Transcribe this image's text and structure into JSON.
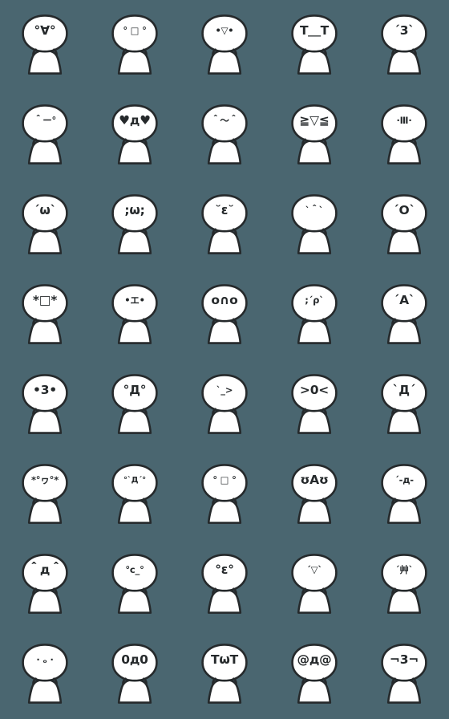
{
  "page": {
    "title": "Kaomoji Blob Emoji Sticker Sheet",
    "background_color": "#4a6670",
    "blob_fill": "#ffffff",
    "blob_outline": "#25292b",
    "face_color": "#25292b",
    "columns": 5,
    "rows": 8,
    "total": 40
  },
  "emojis": [
    {
      "index": 1,
      "face": "°∀°",
      "name": "emoji-happy-open-eyes",
      "size": "f-lg"
    },
    {
      "index": 2,
      "face": "° □ °",
      "name": "emoji-square-mouth-shock",
      "size": "f-sm"
    },
    {
      "index": 3,
      "face": "•▽•",
      "name": "emoji-small-triangle-smile",
      "size": "f-sm"
    },
    {
      "index": 4,
      "face": "T＿T",
      "name": "emoji-crying-tears",
      "size": "f-lg"
    },
    {
      "index": 5,
      "face": "´3`",
      "name": "emoji-kiss-pucker",
      "size": "f-lg"
    },
    {
      "index": 6,
      "face": "＾ー°",
      "name": "emoji-wink-smirk",
      "size": "f-sm"
    },
    {
      "index": 7,
      "face": "♥д♥",
      "name": "emoji-heart-eyes",
      "size": "f-lg"
    },
    {
      "index": 8,
      "face": "＾～＾",
      "name": "emoji-content-wavy-mouth",
      "size": "f-sm"
    },
    {
      "index": 9,
      "face": "≧▽≦",
      "name": "emoji-delighted-squint",
      "size": "f-lg"
    },
    {
      "index": 10,
      "face": "·Ⅲ·",
      "name": "emoji-grid-mouth",
      "size": "f-sm"
    },
    {
      "index": 11,
      "face": "´ω`",
      "name": "emoji-omega-smile",
      "size": "f-lg"
    },
    {
      "index": 12,
      "face": ";ω;",
      "name": "emoji-teary-omega",
      "size": "f-lg"
    },
    {
      "index": 13,
      "face": "˘ε˘",
      "name": "emoji-closed-eyes-kiss",
      "size": "f-lg"
    },
    {
      "index": 14,
      "face": "`＾`",
      "name": "emoji-worried-frown",
      "size": "f-sm"
    },
    {
      "index": 15,
      "face": "´O`",
      "name": "emoji-surprised-oval",
      "size": "f-lg"
    },
    {
      "index": 16,
      "face": "*□*",
      "name": "emoji-starry-square-mouth",
      "size": "f-lg"
    },
    {
      "index": 17,
      "face": "•エ•",
      "name": "emoji-katakana-e-mouth",
      "size": "f-sm"
    },
    {
      "index": 18,
      "face": "o∩o",
      "name": "emoji-arch-mouth",
      "size": "f-lg"
    },
    {
      "index": 19,
      "face": ";´ρ`",
      "name": "emoji-drooling-rho",
      "size": "f-sm"
    },
    {
      "index": 20,
      "face": "´A`",
      "name": "emoji-distressed-a-mouth",
      "size": "f-lg"
    },
    {
      "index": 21,
      "face": "•3•",
      "name": "emoji-whistle-three",
      "size": "f-lg"
    },
    {
      "index": 22,
      "face": "°Д°",
      "name": "emoji-shocked-de",
      "size": "f-lg"
    },
    {
      "index": 23,
      "face": "`_>",
      "name": "emoji-sly-sideways",
      "size": "f-sm"
    },
    {
      "index": 24,
      "face": ">0<",
      "name": "emoji-scrunched-shout",
      "size": "f-lg"
    },
    {
      "index": 25,
      "face": "`Д´",
      "name": "emoji-angry-de",
      "size": "f-lg"
    },
    {
      "index": 26,
      "face": "*°ヮ°*",
      "name": "emoji-sparkle-wa-smile",
      "size": "f-sm"
    },
    {
      "index": 27,
      "face": "°`Д´°",
      "name": "emoji-furious-de",
      "size": "f-xs"
    },
    {
      "index": 28,
      "face": "° □ °",
      "name": "emoji-blank-square-stare",
      "size": "f-sm"
    },
    {
      "index": 29,
      "face": "ʊAʊ",
      "name": "emoji-upsilon-eyes",
      "size": "f-lg"
    },
    {
      "index": 30,
      "face": "´-д-",
      "name": "emoji-sleepy-de",
      "size": "f-sm"
    },
    {
      "index": 31,
      "face": "＾д＾",
      "name": "emoji-grinning-de",
      "size": "f-lg"
    },
    {
      "index": 32,
      "face": "°c_°",
      "name": "emoji-sideways-smirk",
      "size": "f-sm"
    },
    {
      "index": 33,
      "face": "°ε°",
      "name": "emoji-pucker-epsilon",
      "size": "f-lg"
    },
    {
      "index": 34,
      "face": "´▽`",
      "name": "emoji-gentle-triangle-smile",
      "size": "f-sm"
    },
    {
      "index": 35,
      "face": "´艸`",
      "name": "emoji-giggling-kusa",
      "size": "f-sm"
    },
    {
      "index": 36,
      "face": "·  ₒ ·",
      "name": "emoji-blank-dot-face",
      "size": "f-sm"
    },
    {
      "index": 37,
      "face": "0д0",
      "name": "emoji-wide-eyed-de",
      "size": "f-lg"
    },
    {
      "index": 38,
      "face": "TωT",
      "name": "emoji-sobbing-omega",
      "size": "f-lg"
    },
    {
      "index": 39,
      "face": "@д@",
      "name": "emoji-dizzy-spiral",
      "size": "f-lg"
    },
    {
      "index": 40,
      "face": "¬3¬",
      "name": "emoji-smug-pucker",
      "size": "f-lg"
    }
  ]
}
